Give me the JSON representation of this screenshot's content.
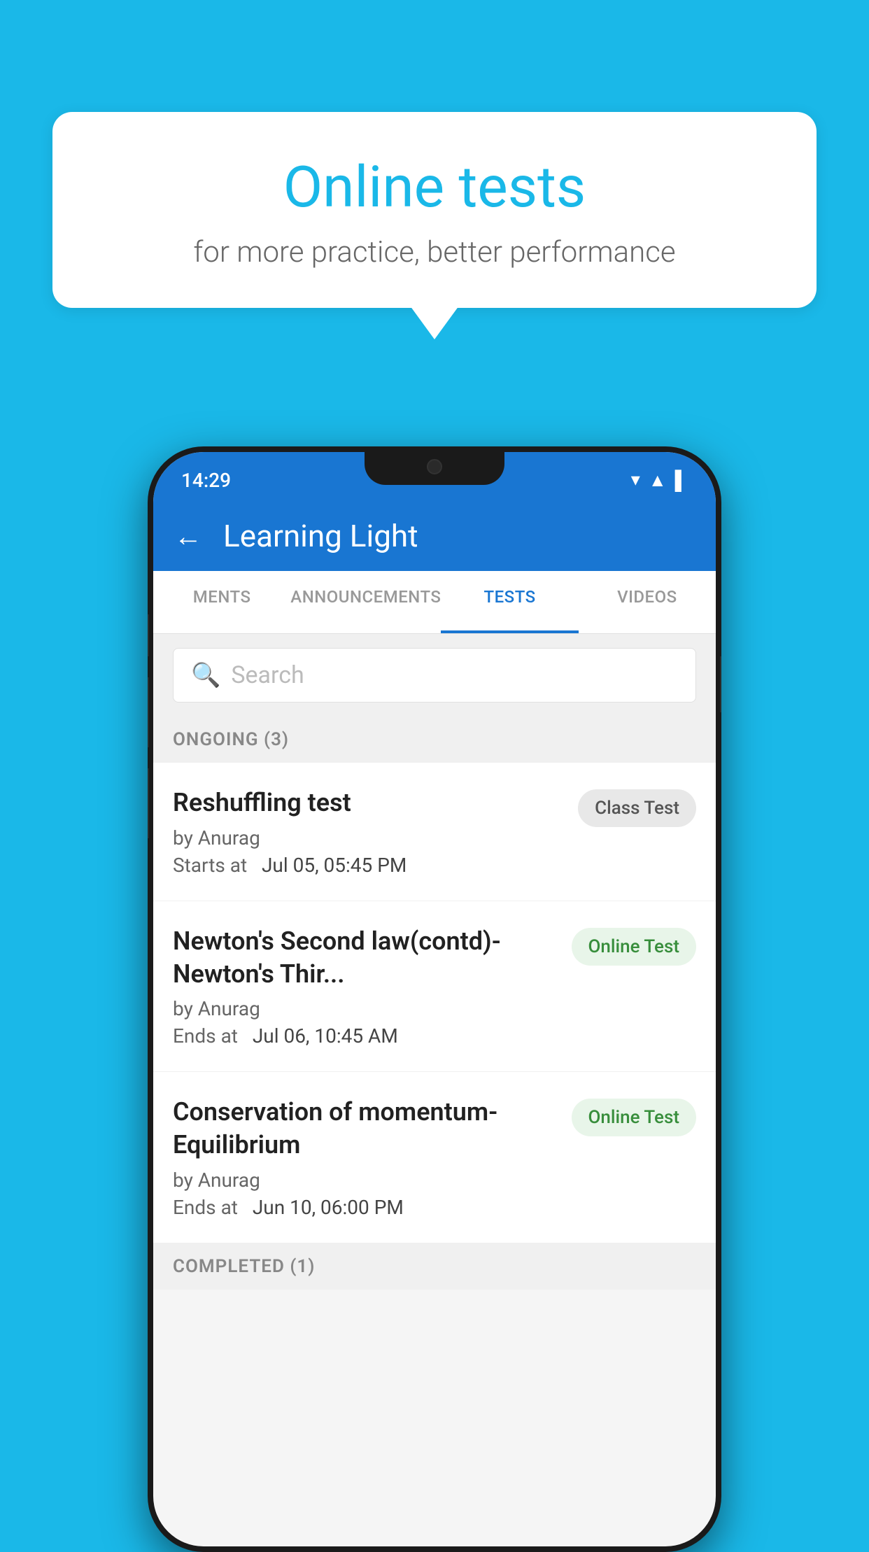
{
  "background_color": "#1ab8e8",
  "speech_bubble": {
    "title": "Online tests",
    "subtitle": "for more practice, better performance"
  },
  "status_bar": {
    "time": "14:29",
    "icons": [
      "wifi",
      "signal",
      "battery"
    ]
  },
  "app_header": {
    "back_label": "←",
    "title": "Learning Light"
  },
  "tabs": [
    {
      "label": "MENTS",
      "active": false
    },
    {
      "label": "ANNOUNCEMENTS",
      "active": false
    },
    {
      "label": "TESTS",
      "active": true
    },
    {
      "label": "VIDEOS",
      "active": false
    }
  ],
  "search": {
    "placeholder": "Search"
  },
  "ongoing_section": {
    "label": "ONGOING (3)"
  },
  "tests": [
    {
      "title": "Reshuffling test",
      "author": "by Anurag",
      "date_label": "Starts at",
      "date_value": "Jul 05, 05:45 PM",
      "badge": "Class Test",
      "badge_type": "class"
    },
    {
      "title": "Newton's Second law(contd)-Newton's Thir...",
      "author": "by Anurag",
      "date_label": "Ends at",
      "date_value": "Jul 06, 10:45 AM",
      "badge": "Online Test",
      "badge_type": "online"
    },
    {
      "title": "Conservation of momentum-Equilibrium",
      "author": "by Anurag",
      "date_label": "Ends at",
      "date_value": "Jun 10, 06:00 PM",
      "badge": "Online Test",
      "badge_type": "online"
    }
  ],
  "completed_section": {
    "label": "COMPLETED (1)"
  }
}
